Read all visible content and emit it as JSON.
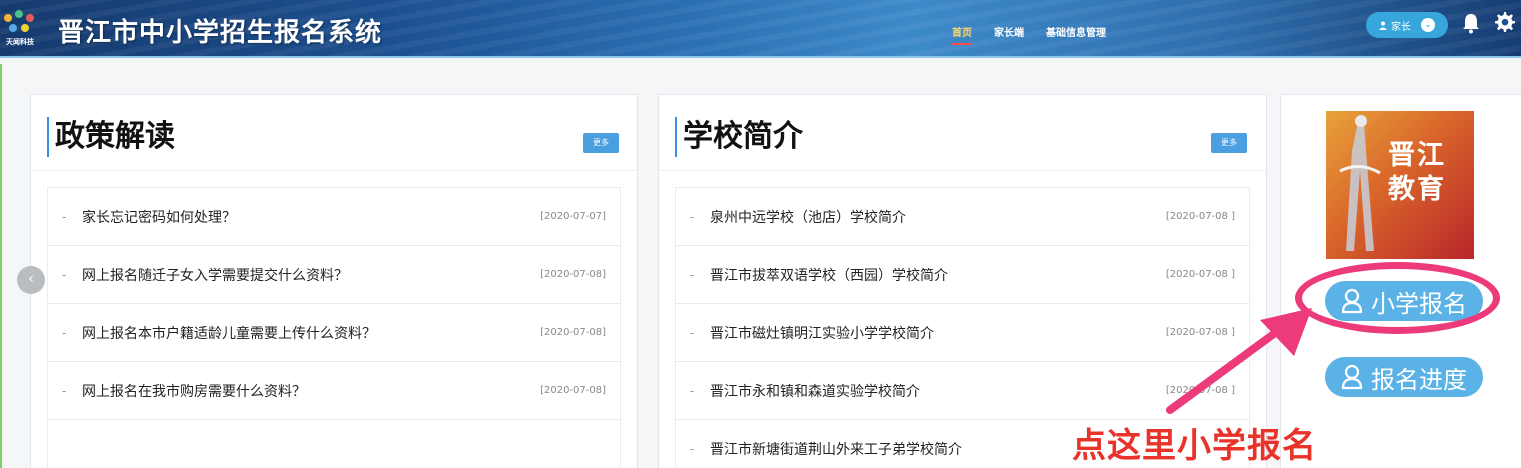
{
  "header": {
    "logo_text": "天闻科技",
    "title": "晋江市中小学招生报名系统",
    "nav": [
      "首页",
      "家长端",
      "基础信息管理"
    ],
    "user_label": "家长",
    "user_icon": "person-icon",
    "chevron": "chevron-down-icon",
    "bell": "bell-icon",
    "gear": "gear-icon"
  },
  "policy": {
    "title": "政策解读",
    "more": "更多",
    "items": [
      {
        "title": "家长忘记密码如何处理？",
        "date": "[2020-07-07]"
      },
      {
        "title": "网上报名随迁子女入学需要提交什么资料？",
        "date": "[2020-07-08]"
      },
      {
        "title": "网上报名本市户籍适龄儿童需要上传什么资料？",
        "date": "[2020-07-08]"
      },
      {
        "title": "网上报名在我市购房需要什么资料？",
        "date": "[2020-07-08]"
      }
    ]
  },
  "schools": {
    "title": "学校简介",
    "more": "更多",
    "items": [
      {
        "title": "泉州中远学校（池店）学校简介",
        "date": "[2020-07-08 ]"
      },
      {
        "title": "晋江市拔萃双语学校（西园）学校简介",
        "date": "[2020-07-08 ]"
      },
      {
        "title": "晋江市磁灶镇明江实验小学学校简介",
        "date": "[2020-07-08 ]"
      },
      {
        "title": "晋江市永和镇和森道实验学校简介",
        "date": "[2020-07-08 ]"
      },
      {
        "title": "晋江市新塘街道荆山外来工子弟学校简介",
        "date": ""
      }
    ]
  },
  "sidebar": {
    "banner_text": [
      "晋江",
      "教育"
    ],
    "enroll_button": "小学报名",
    "progress_button": "报名进度"
  },
  "annotation": {
    "callout": "点这里小学报名",
    "color": "#e8322a",
    "ring_color": "#ec3a7a"
  },
  "carousel": {
    "prev": "‹"
  }
}
